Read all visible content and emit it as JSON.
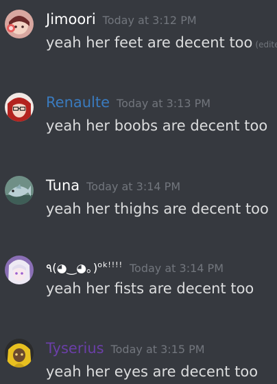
{
  "colors": {
    "background": "#36393f",
    "message_text": "#dcddde",
    "timestamp": "#72767d"
  },
  "messages": [
    {
      "username": "Jimoori",
      "username_color": "#ffffff",
      "timestamp": "Today at 3:12 PM",
      "content": "yeah her feet are decent too",
      "edited": "(edited)",
      "avatar_icon": "anime-girl-headphones-avatar"
    },
    {
      "username": "Renaulte",
      "username_color": "#3a7bbf",
      "timestamp": "Today at 3:13 PM",
      "content": "yeah her boobs are decent too",
      "avatar_icon": "red-hair-glasses-avatar"
    },
    {
      "username": "Tuna",
      "username_color": "#ffffff",
      "timestamp": "Today at 3:14 PM",
      "content": "yeah her thighs are decent too",
      "avatar_icon": "fish-avatar"
    },
    {
      "username": "٩(◕‿◕｡)",
      "username_suffix": "ok!!!!",
      "username_color": "#ffffff",
      "timestamp": "Today at 3:14 PM",
      "content": "yeah her fists are decent too",
      "avatar_icon": "white-hair-anime-avatar"
    },
    {
      "username": "Tyserius",
      "username_color": "#6b3fa8",
      "timestamp": "Today at 3:15 PM",
      "content": "yeah her eyes are decent too",
      "avatar_icon": "yellow-hood-avatar"
    }
  ]
}
